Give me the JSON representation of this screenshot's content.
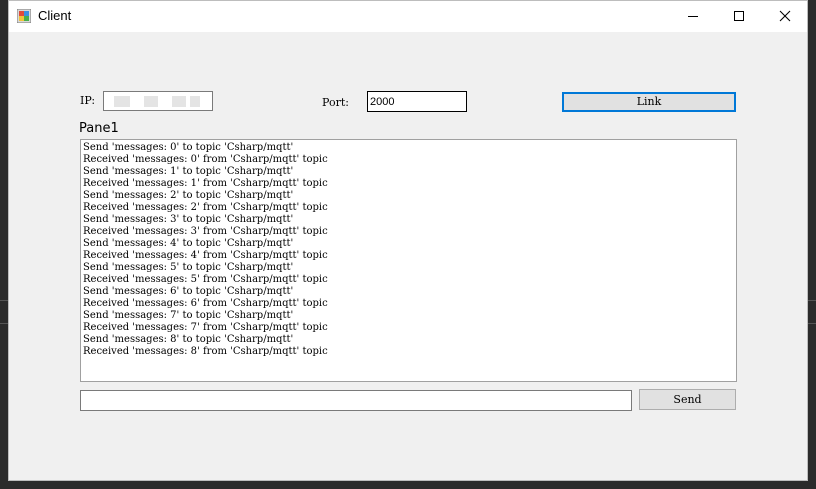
{
  "window": {
    "title": "Client"
  },
  "form": {
    "ip_label": "IP:",
    "port_label": "Port:",
    "port_value": "2000",
    "link_label": "Link",
    "panel_label": "Pane1",
    "send_label": "Send",
    "message_value": ""
  },
  "log": {
    "lines": [
      "Send 'messages: 0' to topic 'Csharp/mqtt'",
      "Received 'messages: 0' from 'Csharp/mqtt' topic",
      "Send 'messages: 1' to topic 'Csharp/mqtt'",
      "Received 'messages: 1' from 'Csharp/mqtt' topic",
      "Send 'messages: 2' to topic 'Csharp/mqtt'",
      "Received 'messages: 2' from 'Csharp/mqtt' topic",
      "Send 'messages: 3' to topic 'Csharp/mqtt'",
      "Received 'messages: 3' from 'Csharp/mqtt' topic",
      "Send 'messages: 4' to topic 'Csharp/mqtt'",
      "Received 'messages: 4' from 'Csharp/mqtt' topic",
      "Send 'messages: 5' to topic 'Csharp/mqtt'",
      "Received 'messages: 5' from 'Csharp/mqtt' topic",
      "Send 'messages: 6' to topic 'Csharp/mqtt'",
      "Received 'messages: 6' from 'Csharp/mqtt' topic",
      "Send 'messages: 7' to topic 'Csharp/mqtt'",
      "Received 'messages: 7' from 'Csharp/mqtt' topic",
      "Send 'messages: 8' to topic 'Csharp/mqtt'",
      "Received 'messages: 8' from 'Csharp/mqtt' topic"
    ]
  },
  "colors": {
    "accent": "#0078d7",
    "window_bg": "#f0f0f0"
  }
}
